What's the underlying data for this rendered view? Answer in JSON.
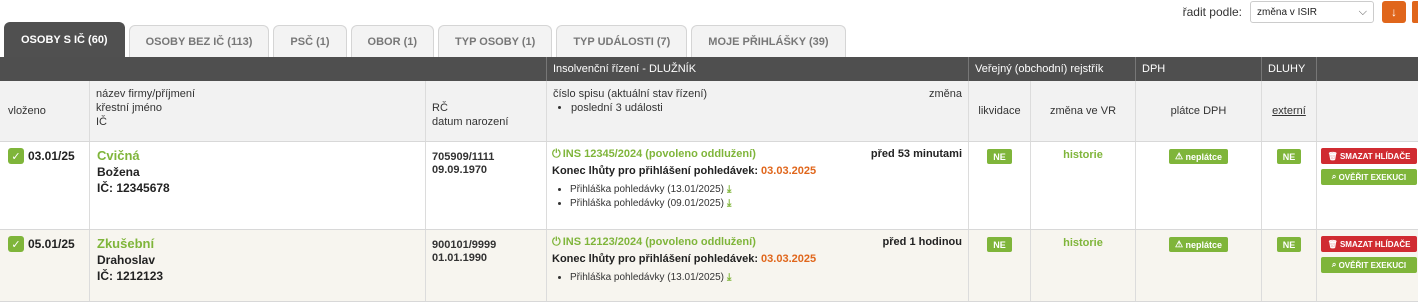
{
  "sort": {
    "label": "řadit podle:",
    "value": "změna v ISIR",
    "direction_icon": "arrow-down-icon"
  },
  "tabs": [
    {
      "label": "OSOBY S IČ (60)",
      "active": true
    },
    {
      "label": "OSOBY BEZ IČ (113)"
    },
    {
      "label": "PSČ (1)"
    },
    {
      "label": "OBOR (1)"
    },
    {
      "label": "TYP OSOBY (1)"
    },
    {
      "label": "TYP UDÁLOSTI (7)"
    },
    {
      "label": "MOJE PŘIHLÁŠKY (39)"
    }
  ],
  "header_groups": {
    "insolvency": "Insolvenční řízení - DLUŽNÍK",
    "register": "Veřejný (obchodní) rejstřík",
    "vat": "DPH",
    "debts": "DLUHY"
  },
  "columns": {
    "inserted": "vloženo",
    "name_l1": "název firmy/příjmení",
    "name_l2": "křestní jméno",
    "name_l3": "IČ",
    "rc_l1": "RČ",
    "rc_l2": "datum narození",
    "file_l1": "číslo spisu (aktuální stav řízení)",
    "file_l2": "poslední 3 události",
    "change": "změna",
    "liquidation": "likvidace",
    "vr_change": "změna ve VR",
    "vat_payer": "plátce DPH",
    "external": "externí"
  },
  "rows": [
    {
      "date": "03.01/25",
      "company": "Cvičná",
      "first_name": "Božena",
      "ico": "IČ: 12345678",
      "rc": "705909/1111",
      "birth": "09.09.1970",
      "ins": "INS 12345/2024 (povoleno oddlužení)",
      "ago": "před 53 minutami",
      "deadline_label": "Konec lhůty pro přihlášení pohledávek:",
      "deadline_date": "03.03.2025",
      "events": [
        "Přihláška pohledávky (13.01/2025)",
        "Přihláška pohledávky (09.01/2025)"
      ],
      "liquidation": "NE",
      "vr": "historie",
      "vat": "neplátce",
      "debt": "NE",
      "btn_delete": "SMAZAT HLÍDAČE",
      "btn_verify": "OVĚŘIT EXEKUCI"
    },
    {
      "date": "05.01/25",
      "company": "Zkušební",
      "first_name": "Drahoslav",
      "ico": "IČ: 1212123",
      "rc": "900101/9999",
      "birth": "01.01.1990",
      "ins": "INS 12123/2024 (povoleno oddlužení)",
      "ago": "před 1 hodinou",
      "deadline_label": "Konec lhůty pro přihlášení pohledávek:",
      "deadline_date": "03.03.2025",
      "events": [
        "Přihláška pohledávky (13.01/2025)"
      ],
      "liquidation": "NE",
      "vr": "historie",
      "vat": "neplátce",
      "debt": "NE",
      "btn_delete": "SMAZAT HLÍDAČE",
      "btn_verify": "OVĚŘIT EXEKUCI"
    }
  ],
  "colors": {
    "accent_green": "#7fb53a",
    "accent_orange": "#e0661b",
    "danger_red": "#d02b31",
    "header_dark": "#4f4f4f"
  }
}
